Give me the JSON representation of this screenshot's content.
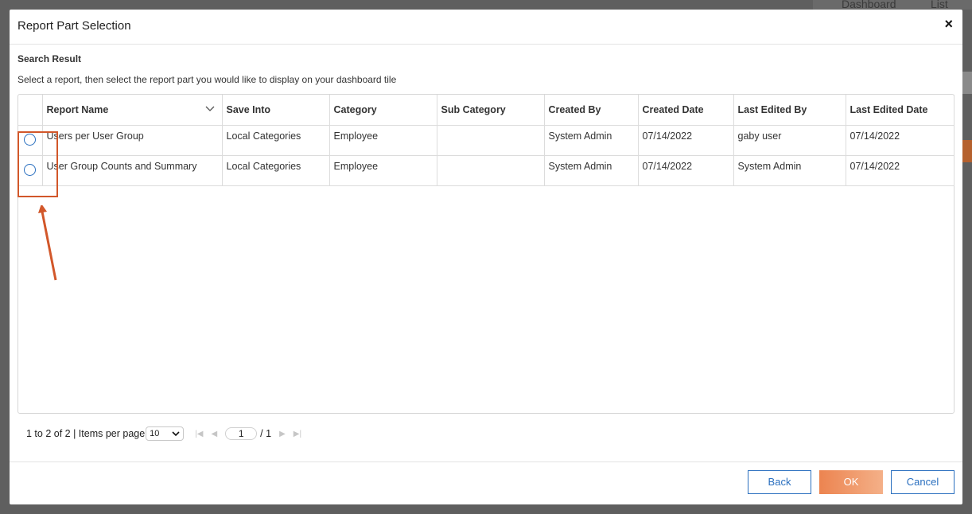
{
  "background": {
    "dashboard_label": "Dashboard",
    "list_label": "List"
  },
  "dialog": {
    "title": "Report Part Selection",
    "close_label": "×"
  },
  "search": {
    "section_title": "Search Result",
    "instructions": "Select a report, then select the report part you would like to display on your dashboard tile"
  },
  "table": {
    "columns": [
      "Report Name",
      "Save Into",
      "Category",
      "Sub Category",
      "Created By",
      "Created Date",
      "Last Edited By",
      "Last Edited Date"
    ],
    "rows": [
      {
        "report_name": "Users per User Group",
        "save_into": "Local Categories",
        "category": "Employee",
        "sub_category": "",
        "created_by": "System Admin",
        "created_date": "07/14/2022",
        "last_edited_by": "gaby user",
        "last_edited_date": "07/14/2022"
      },
      {
        "report_name": "User Group Counts and Summary",
        "save_into": "Local Categories",
        "category": "Employee",
        "sub_category": "",
        "created_by": "System Admin",
        "created_date": "07/14/2022",
        "last_edited_by": "System Admin",
        "last_edited_date": "07/14/2022"
      }
    ]
  },
  "pager": {
    "range_text": "1 to 2 of 2 | Items per page",
    "items_per_page": "10",
    "current_page": "1",
    "total_pages": "/ 1"
  },
  "footer": {
    "back_label": "Back",
    "ok_label": "OK",
    "cancel_label": "Cancel"
  },
  "colors": {
    "accent_blue": "#2a6fbf",
    "highlight_orange": "#d2572a",
    "ok_gradient_start": "#ec8450",
    "ok_gradient_end": "#f4b088"
  },
  "icons": {
    "close": "close-icon",
    "sort": "chevron-down-icon",
    "first": "first-page-icon",
    "prev": "prev-page-icon",
    "next": "next-page-icon",
    "last": "last-page-icon"
  }
}
